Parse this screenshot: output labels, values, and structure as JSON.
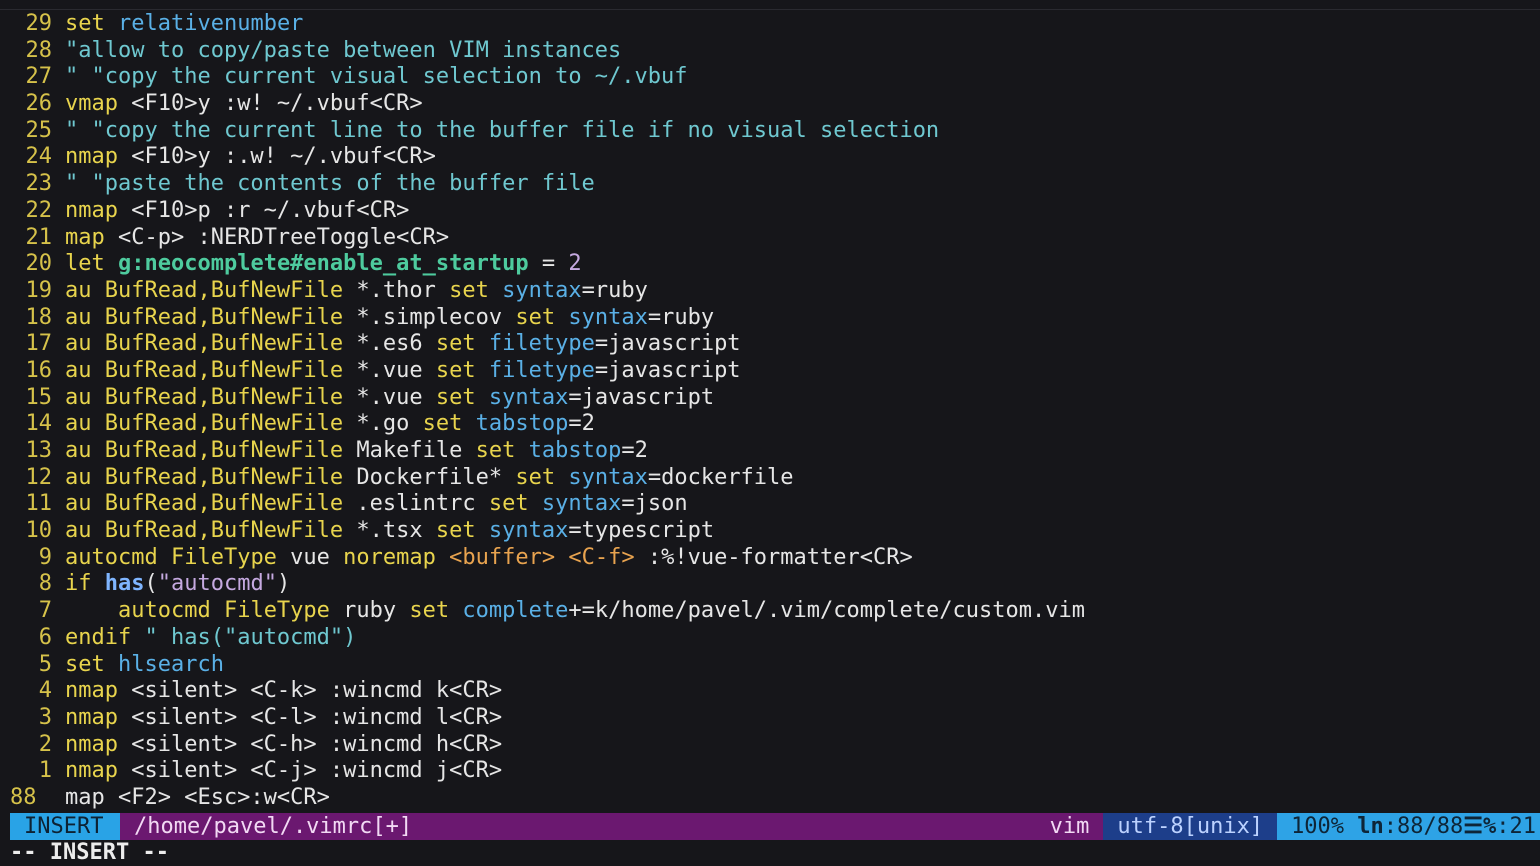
{
  "editor": {
    "lines": [
      {
        "num": "29",
        "tokens": [
          {
            "t": "set",
            "c": "kw"
          },
          {
            "t": " "
          },
          {
            "t": "relativenumber",
            "c": "id"
          }
        ]
      },
      {
        "num": "28",
        "tokens": [
          {
            "t": "\"allow to copy/paste between VIM instances",
            "c": "cm"
          }
        ]
      },
      {
        "num": "27",
        "tokens": [
          {
            "t": "\" \"copy the current visual selection to ~/.vbuf",
            "c": "cm"
          }
        ]
      },
      {
        "num": "26",
        "tokens": [
          {
            "t": "vmap",
            "c": "kw"
          },
          {
            "t": " <F10>y :w! ~/.vbuf<CR>"
          }
        ]
      },
      {
        "num": "25",
        "tokens": [
          {
            "t": "\" \"copy the current line to the buffer file if no visual selection",
            "c": "cm"
          }
        ]
      },
      {
        "num": "24",
        "tokens": [
          {
            "t": "nmap",
            "c": "kw"
          },
          {
            "t": " <F10>y :.w! ~/.vbuf<CR>"
          }
        ]
      },
      {
        "num": "23",
        "tokens": [
          {
            "t": "\" \"paste the contents of the buffer file",
            "c": "cm"
          }
        ]
      },
      {
        "num": "22",
        "tokens": [
          {
            "t": "nmap",
            "c": "kw"
          },
          {
            "t": " <F10>p :r ~/.vbuf<CR>"
          }
        ]
      },
      {
        "num": "21",
        "tokens": [
          {
            "t": "map",
            "c": "kw"
          },
          {
            "t": " <C-p> :NERDTreeToggle<CR>"
          }
        ]
      },
      {
        "num": "20",
        "tokens": [
          {
            "t": "let",
            "c": "kw"
          },
          {
            "t": " "
          },
          {
            "t": "g:neocomplete#enable_at_startup",
            "c": "var"
          },
          {
            "t": " = "
          },
          {
            "t": "2",
            "c": "num"
          }
        ]
      },
      {
        "num": "19",
        "tokens": [
          {
            "t": "au",
            "c": "kw"
          },
          {
            "t": " "
          },
          {
            "t": "BufRead,BufNewFile",
            "c": "ty"
          },
          {
            "t": " *.thor "
          },
          {
            "t": "set",
            "c": "kw"
          },
          {
            "t": " "
          },
          {
            "t": "syntax",
            "c": "id"
          },
          {
            "t": "=ruby"
          }
        ]
      },
      {
        "num": "18",
        "tokens": [
          {
            "t": "au",
            "c": "kw"
          },
          {
            "t": " "
          },
          {
            "t": "BufRead,BufNewFile",
            "c": "ty"
          },
          {
            "t": " *.simplecov "
          },
          {
            "t": "set",
            "c": "kw"
          },
          {
            "t": " "
          },
          {
            "t": "syntax",
            "c": "id"
          },
          {
            "t": "=ruby"
          }
        ]
      },
      {
        "num": "17",
        "tokens": [
          {
            "t": "au",
            "c": "kw"
          },
          {
            "t": " "
          },
          {
            "t": "BufRead,BufNewFile",
            "c": "ty"
          },
          {
            "t": " *.es6 "
          },
          {
            "t": "set",
            "c": "kw"
          },
          {
            "t": " "
          },
          {
            "t": "filetype",
            "c": "id"
          },
          {
            "t": "=javascript"
          }
        ]
      },
      {
        "num": "16",
        "tokens": [
          {
            "t": "au",
            "c": "kw"
          },
          {
            "t": " "
          },
          {
            "t": "BufRead,BufNewFile",
            "c": "ty"
          },
          {
            "t": " *.vue "
          },
          {
            "t": "set",
            "c": "kw"
          },
          {
            "t": " "
          },
          {
            "t": "filetype",
            "c": "id"
          },
          {
            "t": "=javascript"
          }
        ]
      },
      {
        "num": "15",
        "tokens": [
          {
            "t": "au",
            "c": "kw"
          },
          {
            "t": " "
          },
          {
            "t": "BufRead,BufNewFile",
            "c": "ty"
          },
          {
            "t": " *.vue "
          },
          {
            "t": "set",
            "c": "kw"
          },
          {
            "t": " "
          },
          {
            "t": "syntax",
            "c": "id"
          },
          {
            "t": "=javascript"
          }
        ]
      },
      {
        "num": "14",
        "tokens": [
          {
            "t": "au",
            "c": "kw"
          },
          {
            "t": " "
          },
          {
            "t": "BufRead,BufNewFile",
            "c": "ty"
          },
          {
            "t": " *.go "
          },
          {
            "t": "set",
            "c": "kw"
          },
          {
            "t": " "
          },
          {
            "t": "tabstop",
            "c": "id"
          },
          {
            "t": "=2"
          }
        ]
      },
      {
        "num": "13",
        "tokens": [
          {
            "t": "au",
            "c": "kw"
          },
          {
            "t": " "
          },
          {
            "t": "BufRead,BufNewFile",
            "c": "ty"
          },
          {
            "t": " Makefile "
          },
          {
            "t": "set",
            "c": "kw"
          },
          {
            "t": " "
          },
          {
            "t": "tabstop",
            "c": "id"
          },
          {
            "t": "=2"
          }
        ]
      },
      {
        "num": "12",
        "tokens": [
          {
            "t": "au",
            "c": "kw"
          },
          {
            "t": " "
          },
          {
            "t": "BufRead,BufNewFile",
            "c": "ty"
          },
          {
            "t": " Dockerfile* "
          },
          {
            "t": "set",
            "c": "kw"
          },
          {
            "t": " "
          },
          {
            "t": "syntax",
            "c": "id"
          },
          {
            "t": "=dockerfile"
          }
        ]
      },
      {
        "num": "11",
        "tokens": [
          {
            "t": "au",
            "c": "kw"
          },
          {
            "t": " "
          },
          {
            "t": "BufRead,BufNewFile",
            "c": "ty"
          },
          {
            "t": " .eslintrc "
          },
          {
            "t": "set",
            "c": "kw"
          },
          {
            "t": " "
          },
          {
            "t": "syntax",
            "c": "id"
          },
          {
            "t": "=json"
          }
        ]
      },
      {
        "num": "10",
        "tokens": [
          {
            "t": "au",
            "c": "kw"
          },
          {
            "t": " "
          },
          {
            "t": "BufRead,BufNewFile",
            "c": "ty"
          },
          {
            "t": " *.tsx "
          },
          {
            "t": "set",
            "c": "kw"
          },
          {
            "t": " "
          },
          {
            "t": "syntax",
            "c": "id"
          },
          {
            "t": "=typescript"
          }
        ]
      },
      {
        "num": "9",
        "tokens": [
          {
            "t": "autocmd",
            "c": "kw"
          },
          {
            "t": " "
          },
          {
            "t": "FileType",
            "c": "ty"
          },
          {
            "t": " vue "
          },
          {
            "t": "noremap",
            "c": "kw"
          },
          {
            "t": " "
          },
          {
            "t": "<buffer>",
            "c": "sp"
          },
          {
            "t": " "
          },
          {
            "t": "<C-f>",
            "c": "sp"
          },
          {
            "t": " :%!vue-formatter<CR>"
          }
        ]
      },
      {
        "num": "8",
        "tokens": [
          {
            "t": "if",
            "c": "kw"
          },
          {
            "t": " "
          },
          {
            "t": "has",
            "c": "fn"
          },
          {
            "t": "("
          },
          {
            "t": "\"autocmd\"",
            "c": "strv"
          },
          {
            "t": ")"
          }
        ]
      },
      {
        "num": "7",
        "tokens": [
          {
            "t": "    "
          },
          {
            "t": "autocmd",
            "c": "kw"
          },
          {
            "t": " "
          },
          {
            "t": "FileType",
            "c": "ty"
          },
          {
            "t": " ruby "
          },
          {
            "t": "set",
            "c": "kw"
          },
          {
            "t": " "
          },
          {
            "t": "complete",
            "c": "id"
          },
          {
            "t": "+=k/home/pavel/.vim/complete/custom.vim"
          }
        ]
      },
      {
        "num": "6",
        "tokens": [
          {
            "t": "endif",
            "c": "kw"
          },
          {
            "t": " "
          },
          {
            "t": "\" has(\"autocmd\")",
            "c": "cm"
          }
        ]
      },
      {
        "num": "5",
        "tokens": [
          {
            "t": "set",
            "c": "kw"
          },
          {
            "t": " "
          },
          {
            "t": "hlsearch",
            "c": "id"
          }
        ]
      },
      {
        "num": "4",
        "tokens": [
          {
            "t": "nmap",
            "c": "kw"
          },
          {
            "t": " <silent> <C-k> :wincmd k<CR>"
          }
        ]
      },
      {
        "num": "3",
        "tokens": [
          {
            "t": "nmap",
            "c": "kw"
          },
          {
            "t": " <silent> <C-l> :wincmd l<CR>"
          }
        ]
      },
      {
        "num": "2",
        "tokens": [
          {
            "t": "nmap",
            "c": "kw"
          },
          {
            "t": " <silent> <C-h> :wincmd h<CR>"
          }
        ]
      },
      {
        "num": "1",
        "tokens": [
          {
            "t": "nmap",
            "c": "kw"
          },
          {
            "t": " <silent> <C-j> :wincmd j<CR>"
          }
        ]
      },
      {
        "num": "88",
        "current": true,
        "tokens": [
          {
            "t": "map <F2> <Esc>:w<CR>"
          }
        ]
      }
    ]
  },
  "statusline": {
    "mode": "INSERT",
    "file": "/home/pavel/.vimrc[+]",
    "filetype": "vim",
    "encoding": "utf-8[unix]",
    "percent": "100%",
    "ln_label": "ln",
    "position": ":88/88",
    "col_sep": "☰%",
    "column": ":21"
  },
  "cmdline": {
    "text": "-- INSERT --"
  },
  "colors": {
    "background": "#16161a",
    "line_number": "#d6c24a",
    "keyword": "#e8d44d",
    "comment": "#6fc8d0",
    "option": "#5ab0e6",
    "variable": "#4ecb9e",
    "mode_bg": "#29a3e6",
    "file_bg": "#6b1870",
    "encoding_bg": "#1d3e8a"
  }
}
